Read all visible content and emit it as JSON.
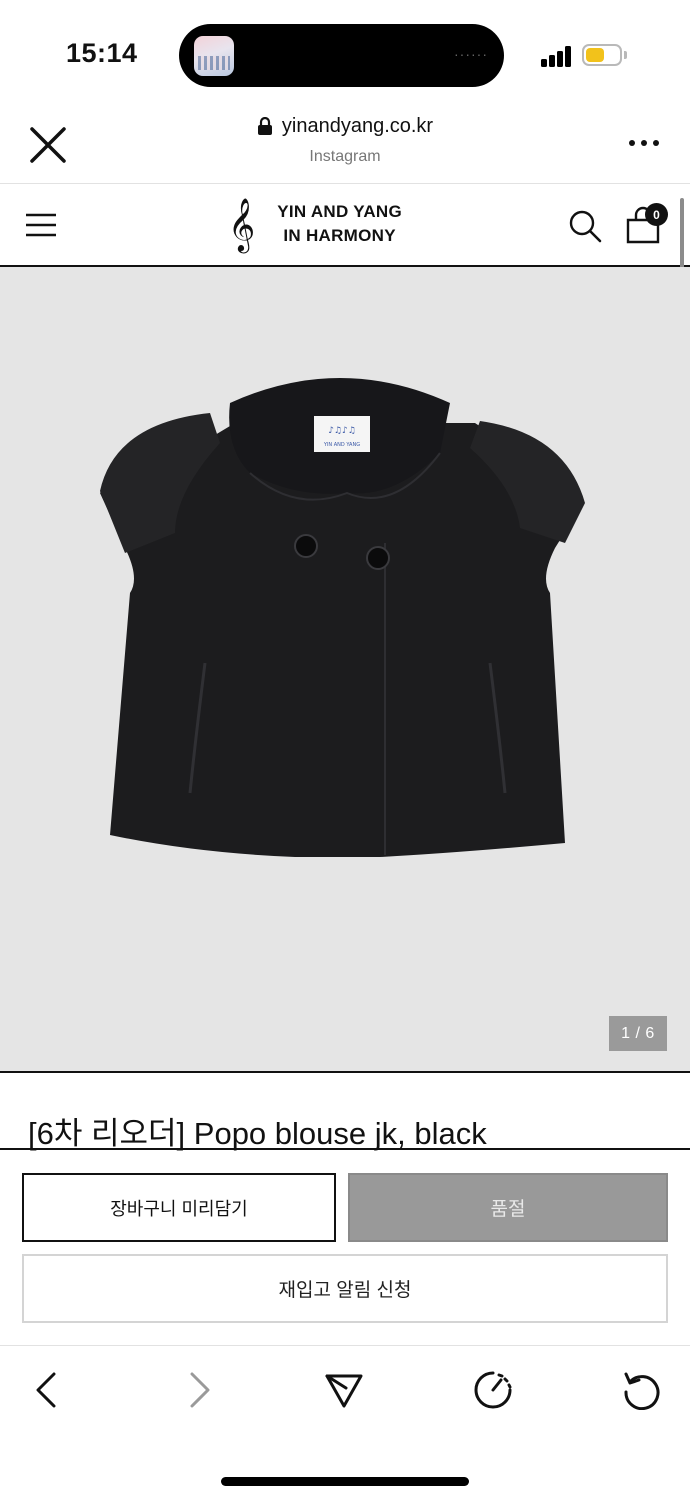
{
  "status_bar": {
    "time": "15:14",
    "island_dots": "······",
    "battery_color": "#f2c21b"
  },
  "browser": {
    "url": "yinandyang.co.kr",
    "source": "Instagram",
    "icons": [
      "close-icon",
      "lock-icon",
      "more-icon"
    ]
  },
  "site": {
    "logo_line1": "YIN AND YANG",
    "logo_line2": "IN HARMONY",
    "logo_symbol": "𝄞",
    "cart_count": "0",
    "icons": [
      "menu-icon",
      "treble-clef-icon",
      "search-icon",
      "shopping-bag-icon"
    ]
  },
  "product": {
    "image_counter": "1 / 6",
    "label_text": "YIN AND YANG IN HARMONY",
    "title": "[6차 리오더] Popo blouse jk, black"
  },
  "actions": {
    "add_to_cart": "장바구니 미리담기",
    "sold_out": "품절",
    "restock_alert": "재입고 알림 신청"
  },
  "toolbar": {
    "icons": [
      "back-icon",
      "forward-icon",
      "share-icon",
      "speed-icon",
      "reload-icon"
    ]
  },
  "colors": {
    "image_bg": "#e5e5e5",
    "sold_out_bg": "#999999",
    "text": "#111111"
  }
}
